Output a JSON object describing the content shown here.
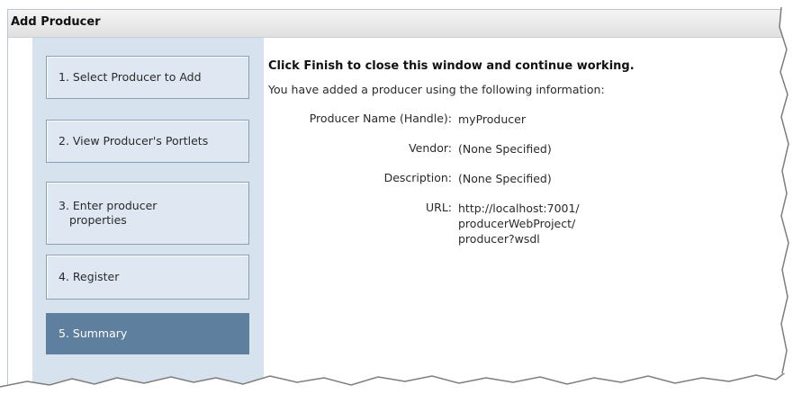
{
  "window": {
    "title": "Add Producer"
  },
  "steps": [
    {
      "label": "1. Select Producer to Add"
    },
    {
      "label_lines": [
        "3. Enter producer",
        "properties"
      ]
    },
    {
      "label": "2. View Producer's Portlets"
    },
    {
      "label": "4. Register"
    },
    {
      "label": "5. Summary",
      "current": true
    }
  ],
  "summary": {
    "headline": "Click Finish to close this window and continue working.",
    "intro": "You have added a producer using the following information:",
    "fields": [
      {
        "label": "Producer Name (Handle):",
        "value_lines": [
          "myProducer"
        ]
      },
      {
        "label": "Vendor:",
        "value_lines": [
          "(None Specified)"
        ]
      },
      {
        "label": "Description:",
        "value_lines": [
          "(None Specified)"
        ]
      },
      {
        "label": "URL:",
        "value_lines": [
          "http://localhost:7001/",
          "producerWebProject/",
          "producer?wsdl"
        ]
      }
    ]
  },
  "colors": {
    "panel_bg": "#d6e2ee",
    "step_bg": "#dfe8f2",
    "step_border": "#8a9fb4",
    "current_step_bg": "#5f7f9e"
  }
}
